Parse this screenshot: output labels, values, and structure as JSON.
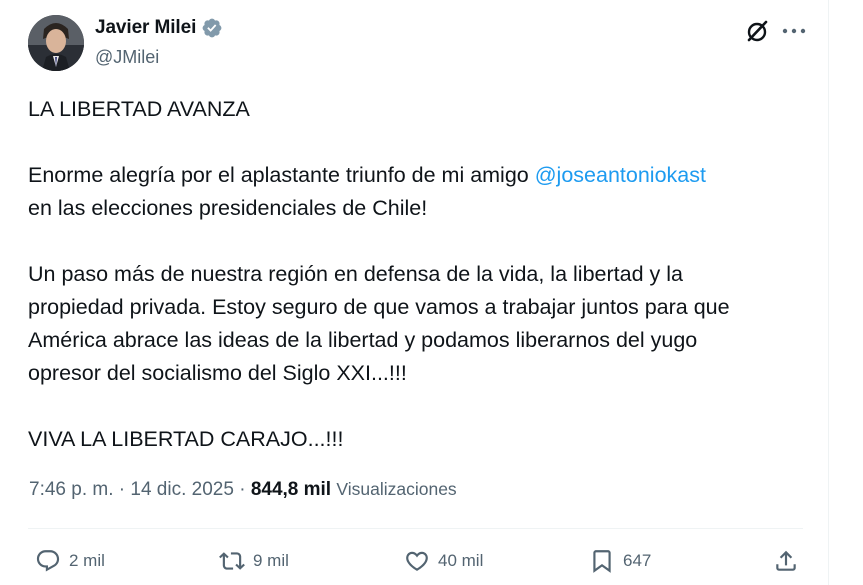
{
  "author": {
    "display_name": "Javier Milei",
    "handle": "@JMilei",
    "verified": true,
    "avatar_icon": "avatar-photo"
  },
  "header_actions": {
    "grok_icon": "grok-icon",
    "more_icon": "more-options-icon"
  },
  "tweet": {
    "line1": "LA LIBERTAD AVANZA",
    "p2_before_mention": "Enorme alegría por el aplastante triunfo de mi amigo ",
    "mention": "@joseantoniokast",
    "p2_after_mention": "en las elecciones presidenciales de Chile!",
    "p3_line1": "Un paso más de nuestra región en defensa de la vida, la libertad y la",
    "p3_line2": "propiedad privada. Estoy seguro de que vamos a trabajar juntos para que",
    "p3_line3": "América abrace las ideas de la libertad y podamos liberarnos del yugo",
    "p3_line4": "opresor del socialismo del Siglo XXI...!!!",
    "p4": "VIVA LA LIBERTAD CARAJO...!!!"
  },
  "meta": {
    "time": "7:46 p. m.",
    "separator": "·",
    "date": "14 dic. 2025",
    "views_count": "844,8 mil",
    "views_label": "Visualizaciones"
  },
  "actions": {
    "replies": "2 mil",
    "reposts": "9 mil",
    "likes": "40 mil",
    "bookmarks": "647"
  },
  "colors": {
    "text": "#0f1419",
    "secondary": "#536471",
    "link": "#1d9bf0",
    "divider": "#eff3f4"
  }
}
